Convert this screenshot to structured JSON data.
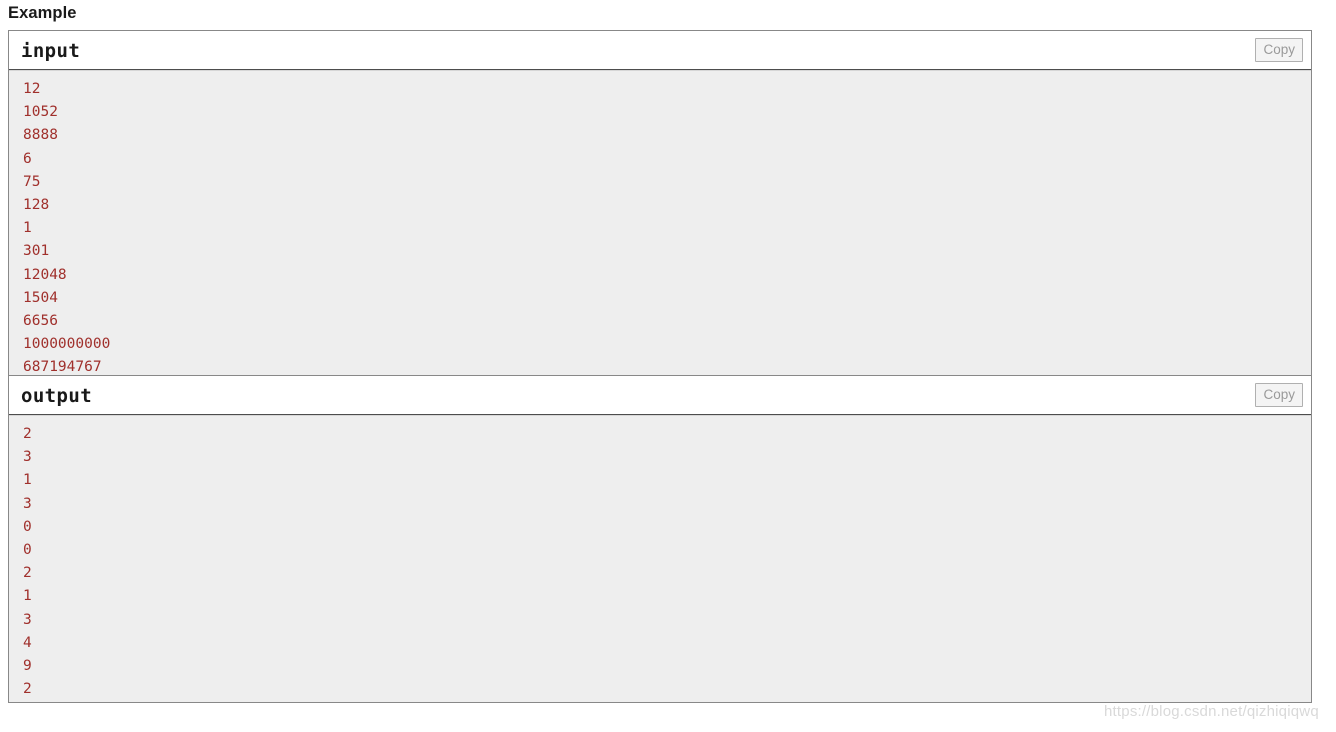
{
  "page": {
    "section_title": "Example",
    "watermark": "https://blog.csdn.net/qizhiqiqwq"
  },
  "sample_tests": [
    {
      "title": "input",
      "copy_label": "Copy",
      "lines": [
        "12",
        "1052",
        "8888",
        "6",
        "75",
        "128",
        "1",
        "301",
        "12048",
        "1504",
        "6656",
        "1000000000",
        "687194767"
      ]
    },
    {
      "title": "output",
      "copy_label": "Copy",
      "lines": [
        "2",
        "3",
        "1",
        "3",
        "0",
        "0",
        "2",
        "1",
        "3",
        "4",
        "9",
        "2"
      ]
    }
  ],
  "colors": {
    "data_text": "#a0302c",
    "body_background": "#eeeeee",
    "border": "#888888",
    "title_text": "#1a1a1a",
    "copy_button_text": "#9a9a9a",
    "watermark_text": "#d9d9d9"
  }
}
